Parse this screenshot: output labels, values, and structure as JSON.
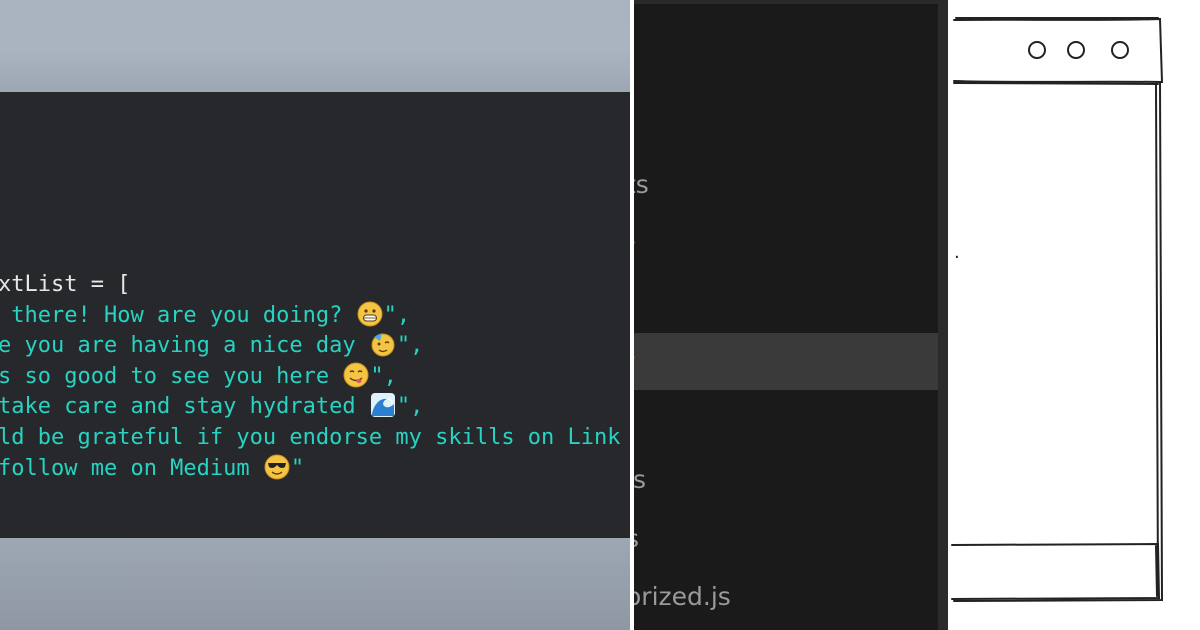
{
  "code_panel": {
    "lines": [
      [
        {
          "t": "xtList = [",
          "c": "plain"
        }
      ],
      [
        {
          "t": " there! How are you doing? ",
          "c": "str"
        },
        {
          "emoji": "grin"
        },
        {
          "t": "\",",
          "c": "str"
        }
      ],
      [
        {
          "t": "e you are having a nice day ",
          "c": "str"
        },
        {
          "emoji": "party"
        },
        {
          "t": "\",",
          "c": "str"
        }
      ],
      [
        {
          "t": "s so good to see you here ",
          "c": "str"
        },
        {
          "emoji": "yum"
        },
        {
          "t": "\",",
          "c": "str"
        }
      ],
      [
        {
          "t": "take care and stay hydrated ",
          "c": "str"
        },
        {
          "emoji": "wave"
        },
        {
          "t": "\",",
          "c": "str"
        }
      ],
      [
        {
          "t": "ld be grateful if you endorse my skills on Link",
          "c": "str"
        }
      ],
      [
        {
          "t": "follow me on Medium ",
          "c": "str"
        },
        {
          "emoji": "cool"
        },
        {
          "t": "\"",
          "c": "str"
        }
      ]
    ],
    "colors": {
      "string": "#27d3c2",
      "plain": "#e7e7e7",
      "background": "#26282b"
    }
  },
  "explorer_panel": {
    "items": [
      {
        "label": "ts"
      },
      {
        "label": "is"
      },
      {
        "label": "s"
      },
      {
        "label": "orized.js"
      }
    ]
  },
  "sketch_panel": {
    "window_controls": [
      "circle-icon",
      "circle-icon",
      "circle-icon"
    ],
    "stray_mark": "."
  }
}
